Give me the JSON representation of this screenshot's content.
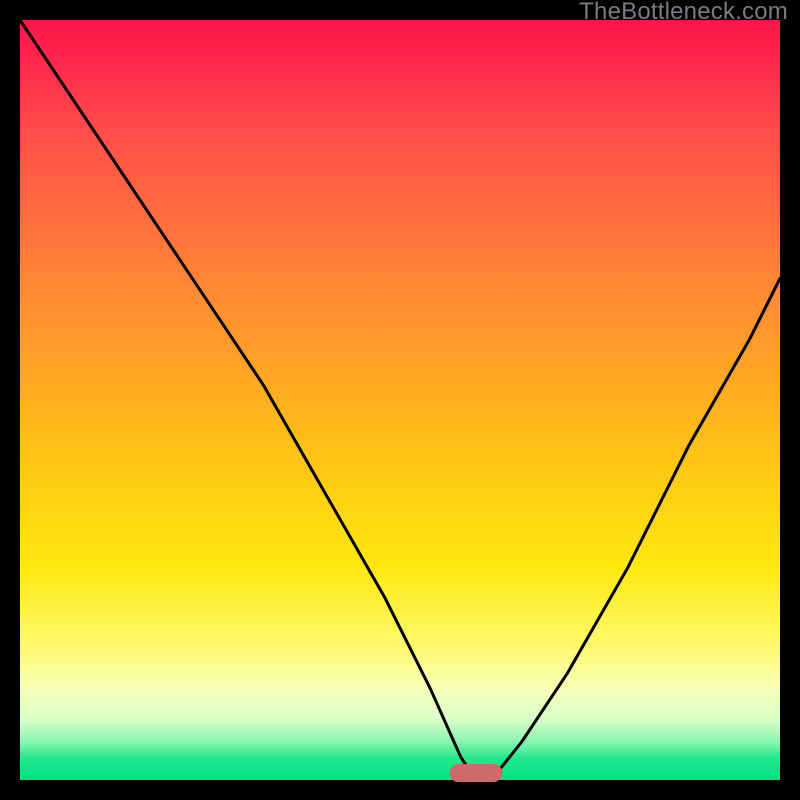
{
  "watermark": "TheBottleneck.com",
  "chart_data": {
    "type": "line",
    "title": "",
    "xlabel": "",
    "ylabel": "",
    "xlim": [
      0,
      100
    ],
    "ylim": [
      0,
      100
    ],
    "grid": false,
    "series": [
      {
        "name": "bottleneck-curve",
        "x": [
          0,
          8,
          16,
          24,
          32,
          40,
          48,
          54,
          58,
          60,
          62,
          66,
          72,
          80,
          88,
          96,
          100
        ],
        "values": [
          100,
          88,
          76,
          64,
          52,
          38,
          24,
          12,
          3,
          0,
          0,
          5,
          14,
          28,
          44,
          58,
          66
        ]
      }
    ],
    "marker": {
      "x_center": 60,
      "width": 7,
      "color": "#cf6a6a"
    },
    "gradient_stops": [
      {
        "pos": 0,
        "color": "#ff1449"
      },
      {
        "pos": 25,
        "color": "#ff6a3f"
      },
      {
        "pos": 50,
        "color": "#ffb41a"
      },
      {
        "pos": 75,
        "color": "#fff060"
      },
      {
        "pos": 95,
        "color": "#88f5b0"
      },
      {
        "pos": 100,
        "color": "#00e080"
      }
    ]
  }
}
